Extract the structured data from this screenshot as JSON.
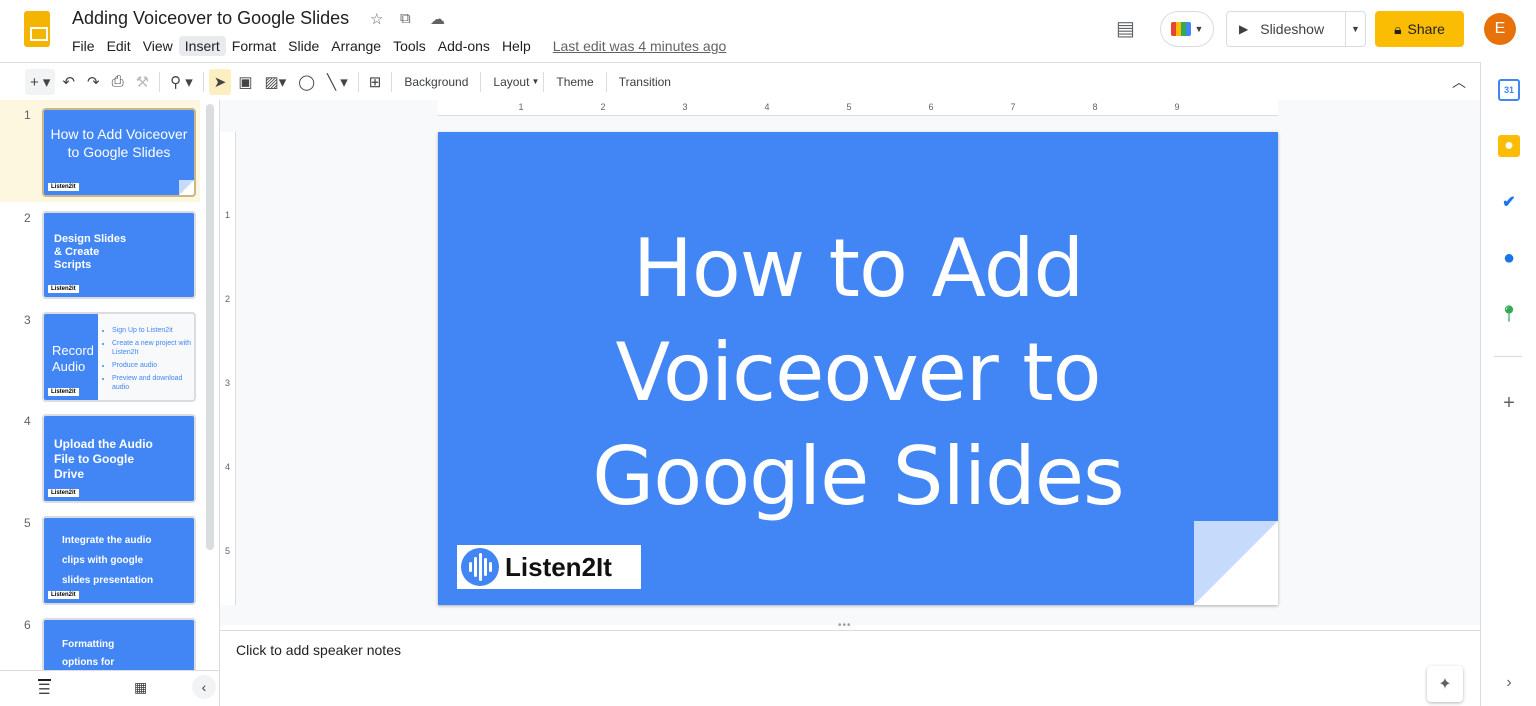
{
  "header": {
    "title": "Adding Voiceover to Google Slides",
    "menu": [
      "File",
      "Edit",
      "View",
      "Insert",
      "Format",
      "Slide",
      "Arrange",
      "Tools",
      "Add-ons",
      "Help"
    ],
    "last_edit": "Last edit was 4 minutes ago",
    "slideshow": "Slideshow",
    "share": "Share",
    "avatar": "E"
  },
  "toolbar": {
    "background": "Background",
    "layout": "Layout",
    "theme": "Theme",
    "transition": "Transition"
  },
  "ruler": {
    "top": [
      "1",
      "2",
      "3",
      "4",
      "5",
      "6",
      "7",
      "8",
      "9"
    ],
    "left": [
      "1",
      "2",
      "3",
      "4",
      "5"
    ]
  },
  "slides": [
    {
      "num": "1",
      "title": "How to Add Voiceover to Google Slides"
    },
    {
      "num": "2",
      "title": "Design Slides & Create Scripts"
    },
    {
      "num": "3",
      "title": "Record Audio",
      "bullets": [
        "Sign Up to Listen2it",
        "Create a new project with Listen2It",
        "Produce audio",
        "Preview and download audio"
      ]
    },
    {
      "num": "4",
      "title": "Upload the Audio File to Google Drive"
    },
    {
      "num": "5",
      "title": "Integrate the audio clips with google slides presentation"
    },
    {
      "num": "6",
      "title": "Formatting options for voiceover on"
    }
  ],
  "main": {
    "title": "How to Add Voiceover to Google Slides",
    "brand": "Listen2It",
    "mini_brand": "Listen2it",
    "notes_placeholder": "Click to add speaker notes"
  },
  "colors": {
    "slide_bg": "#4285f4",
    "share": "#fbbc04",
    "avatar": "#e8710a"
  }
}
